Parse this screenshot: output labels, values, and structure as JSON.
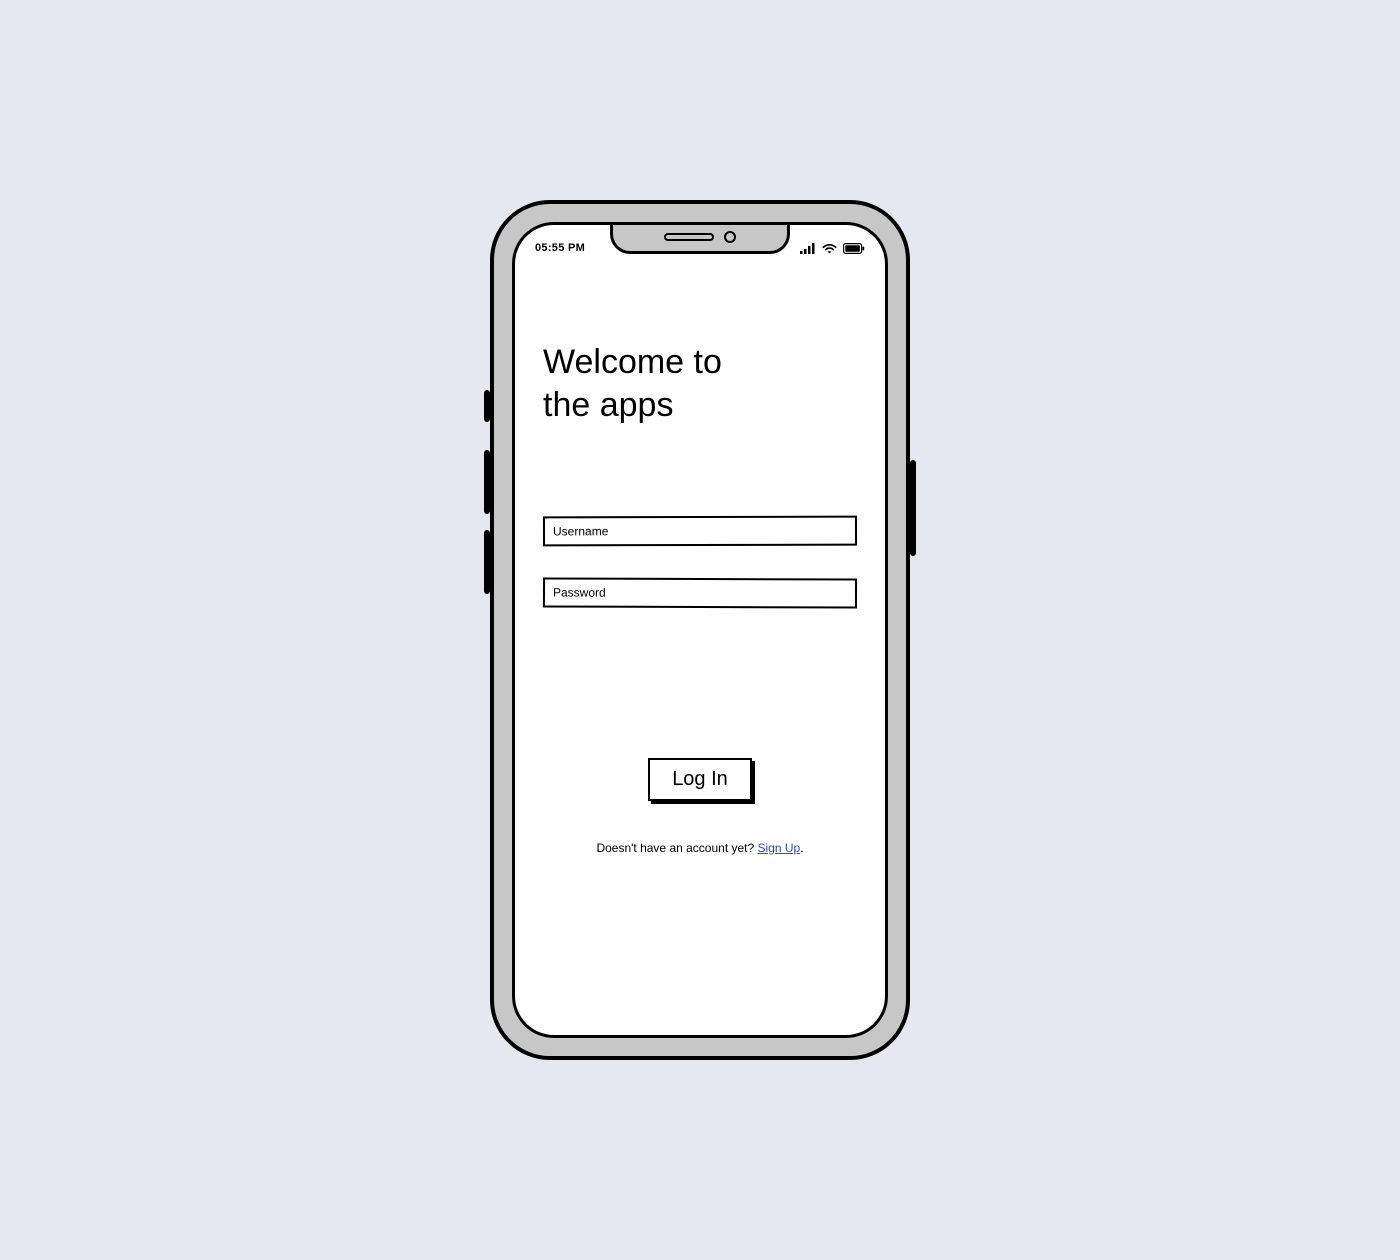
{
  "status": {
    "time": "05:55 PM"
  },
  "heading": {
    "line1": "Welcome to",
    "line2": "the apps"
  },
  "form": {
    "username_placeholder": "Username",
    "password_placeholder": "Password"
  },
  "actions": {
    "login_label": "Log In"
  },
  "signup": {
    "prompt": "Doesn't have an account yet? ",
    "link_label": "Sign Up"
  }
}
